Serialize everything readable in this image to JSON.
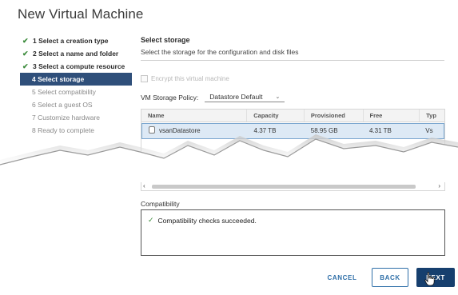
{
  "dialog": {
    "title": "New Virtual Machine"
  },
  "steps": [
    {
      "label": "1 Select a creation type",
      "state": "done"
    },
    {
      "label": "2 Select a name and folder",
      "state": "done"
    },
    {
      "label": "3 Select a compute resource",
      "state": "done"
    },
    {
      "label": "4 Select storage",
      "state": "active"
    },
    {
      "label": "5 Select compatibility",
      "state": "pending"
    },
    {
      "label": "6 Select a guest OS",
      "state": "pending"
    },
    {
      "label": "7 Customize hardware",
      "state": "pending"
    },
    {
      "label": "8 Ready to complete",
      "state": "pending"
    }
  ],
  "storage": {
    "title": "Select storage",
    "subtitle": "Select the storage for the configuration and disk files",
    "disable_sdrs_label": "Encrypt this virtual machine",
    "policy_label": "VM Storage Policy:",
    "policy_value": "Datastore Default"
  },
  "table": {
    "columns": [
      "Name",
      "Capacity",
      "Provisioned",
      "Free",
      "Typ"
    ],
    "rows": [
      {
        "name": "vsanDatastore",
        "capacity": "4.37 TB",
        "provisioned": "58.95 GB",
        "free": "4.31 TB",
        "type": "Vs"
      }
    ]
  },
  "compatibility": {
    "label": "Compatibility",
    "message": "Compatibility checks succeeded."
  },
  "footer": {
    "cancel": "CANCEL",
    "back": "BACK",
    "next": "NEXT"
  },
  "icons": {
    "check": "checkmark-icon",
    "datastore": "datastore-icon",
    "cursor": "hand-pointer-icon"
  },
  "colors": {
    "active_step": "#2f4f7a",
    "primary_button": "#163f6e",
    "link": "#2f6fa8",
    "success": "#3a8a3a"
  }
}
